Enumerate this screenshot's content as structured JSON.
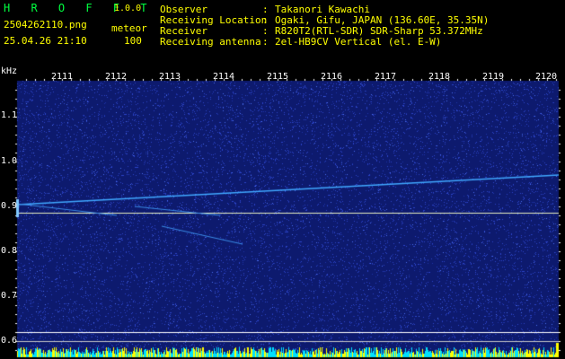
{
  "header": {
    "app_title": "H R O F F T",
    "version": "1.0.0",
    "filename": "2504262110.png",
    "label_meteor": "meteor",
    "datetime": "25.04.26 21:10",
    "meteor_count": "100",
    "info_labels": [
      "Observer",
      "Receiving Location",
      "Receiver",
      "Receiving antenna"
    ],
    "info_separator": ":",
    "info_values": [
      "Takanori Kawachi",
      "Ogaki, Gifu, JAPAN (136.60E, 35.35N)",
      "R820T2(RTL-SDR) SDR-Sharp 53.372MHz",
      "2el-HB9CV Vertical (el. E-W)"
    ]
  },
  "axis": {
    "y_unit": "kHz",
    "y_ticks": [
      "1.1",
      "1.0",
      "0.9",
      "0.8",
      "0.7",
      "0.6"
    ],
    "x_ticks": [
      "2111",
      "2112",
      "2113",
      "2114",
      "2115",
      "2116",
      "2117",
      "2118",
      "2119",
      "2120"
    ]
  },
  "colors": {
    "background": "#000000",
    "plot_bg": "#0d1a6e",
    "noise": "#2c44c8",
    "trace": "#40a8ff",
    "carrier": "#e8f0c0",
    "header_green": "#00ff40",
    "header_yellow": "#ffff00",
    "level_cyan": "#00e0ff",
    "level_yellow": "#ffff00"
  }
}
